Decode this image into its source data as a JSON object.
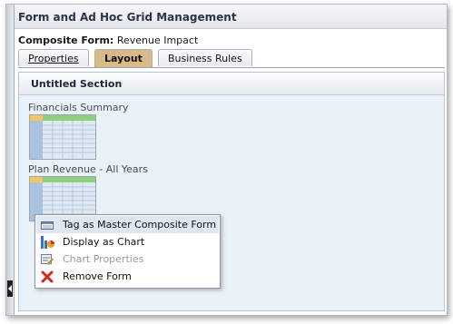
{
  "window": {
    "title": "Form and Ad Hoc Grid Management"
  },
  "composite": {
    "label": "Composite Form:",
    "name": "Revenue Impact"
  },
  "tabs": [
    {
      "label": "Properties"
    },
    {
      "label": "Layout"
    },
    {
      "label": "Business Rules"
    }
  ],
  "section": {
    "title": "Untitled Section",
    "forms": [
      {
        "label": "Financials Summary",
        "icon": "grid-form-icon"
      },
      {
        "label": "Plan Revenue - All Years",
        "icon": "grid-form-icon"
      }
    ]
  },
  "context_menu": {
    "items": [
      {
        "label": "Tag as Master Composite Form",
        "icon": "master-tag-icon",
        "enabled": true,
        "highlighted": true
      },
      {
        "label": "Display as Chart",
        "icon": "chart-icon",
        "enabled": true
      },
      {
        "label": "Chart Properties",
        "icon": "chart-properties-icon",
        "enabled": false
      },
      {
        "label": "Remove Form",
        "icon": "remove-x-icon",
        "enabled": true
      }
    ]
  },
  "colors": {
    "active_tab": "#d9ba86",
    "section_bg": "#e9f1f9",
    "grid_header_orange": "#f7c463",
    "grid_header_green": "#8fd07f",
    "remove_icon": "#d9271b"
  }
}
